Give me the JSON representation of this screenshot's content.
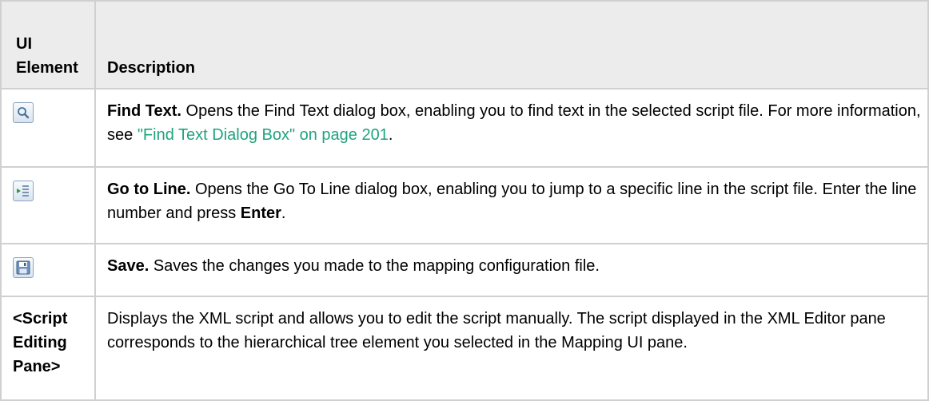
{
  "header": {
    "col1": "UI Element",
    "col1_line1": "UI",
    "col1_line2": "Element",
    "col2": "Description"
  },
  "rows": [
    {
      "icon": "find-text-icon",
      "title": "Find Text.",
      "text1": " Opens the Find Text dialog box, enabling you to find text in the selected script file. For more information, see ",
      "link": "\"Find Text Dialog Box\" on page 201",
      "text2": "."
    },
    {
      "icon": "go-to-line-icon",
      "title": "Go to Line.",
      "text1": " Opens the Go To Line dialog box, enabling you to jump to a specific line in the script file. Enter the line number and press ",
      "bold2": "Enter",
      "text2": "."
    },
    {
      "icon": "save-icon",
      "title": "Save.",
      "text1": " Saves the changes you made to the mapping configuration file."
    },
    {
      "label_line1": "<Script",
      "label_line2": "Editing",
      "label_line3": "Pane>",
      "text1": "Displays the XML script and allows you to edit the script manually. The script displayed in the XML Editor pane corresponds to the hierarchical tree element you selected in the Mapping UI pane."
    }
  ],
  "colors": {
    "link": "#1fa37e",
    "border": "#d0d0d0",
    "header_bg": "#ececec"
  }
}
